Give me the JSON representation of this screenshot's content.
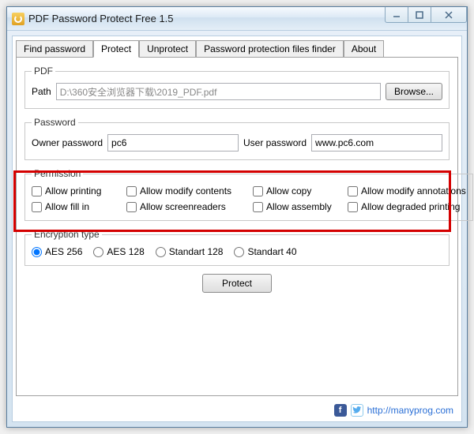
{
  "window": {
    "title": "PDF Password Protect Free 1.5"
  },
  "tabs": {
    "find": "Find password",
    "protect": "Protect",
    "unprotect": "Unprotect",
    "finder": "Password protection files finder",
    "about": "About"
  },
  "pdf": {
    "legend": "PDF",
    "path_label": "Path",
    "path_value": "D:\\360安全浏览器下载\\2019_PDF.pdf",
    "browse": "Browse..."
  },
  "password": {
    "legend": "Password",
    "owner_label": "Owner password",
    "owner_value": "pc6",
    "user_label": "User password",
    "user_value": "www.pc6.com"
  },
  "permission": {
    "legend": "Permission",
    "allow_printing": "Allow printing",
    "allow_modify_contents": "Allow modify contents",
    "allow_copy": "Allow copy",
    "allow_modify_annotations": "Allow modify annotations",
    "allow_fill_in": "Allow fill in",
    "allow_screenreaders": "Allow screenreaders",
    "allow_assembly": "Allow assembly",
    "allow_degraded_printing": "Allow degraded printing"
  },
  "encryption": {
    "legend": "Encryption type",
    "aes256": "AES 256",
    "aes128": "AES 128",
    "std128": "Standart 128",
    "std40": "Standart 40"
  },
  "actions": {
    "protect": "Protect"
  },
  "footer": {
    "fb": "f",
    "tw": "t",
    "url": "http://manyprog.com"
  }
}
